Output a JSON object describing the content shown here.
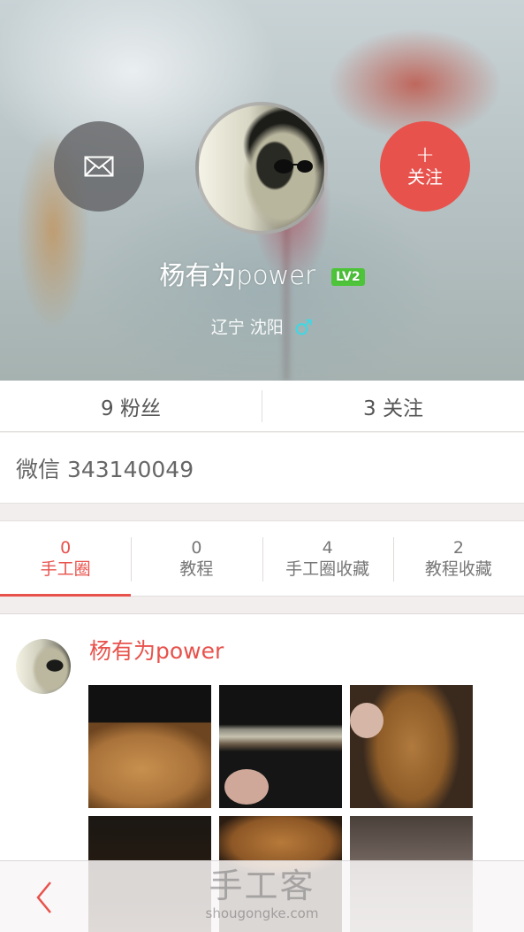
{
  "profile": {
    "username": "杨有为power",
    "level_badge": "LV2",
    "location": "辽宁 沈阳",
    "gender_symbol": "♂",
    "follow_plus": "+",
    "follow_label": "关注"
  },
  "stats": {
    "fans": "9 粉丝",
    "following": "3 关注"
  },
  "wechat": "微信 343140049",
  "tabs": [
    {
      "count": "0",
      "label": "手工圈"
    },
    {
      "count": "0",
      "label": "教程"
    },
    {
      "count": "4",
      "label": "手工圈收藏"
    },
    {
      "count": "2",
      "label": "教程收藏"
    }
  ],
  "post": {
    "author": "杨有为power"
  },
  "watermark": {
    "main": "手工客",
    "sub": "shougongke.com"
  },
  "icons": {
    "mail": "mail-icon",
    "back": "chevron-left-icon"
  },
  "colors": {
    "accent": "#e8524c",
    "level_badge": "#4ec43a",
    "gender": "#3fd8e4"
  }
}
